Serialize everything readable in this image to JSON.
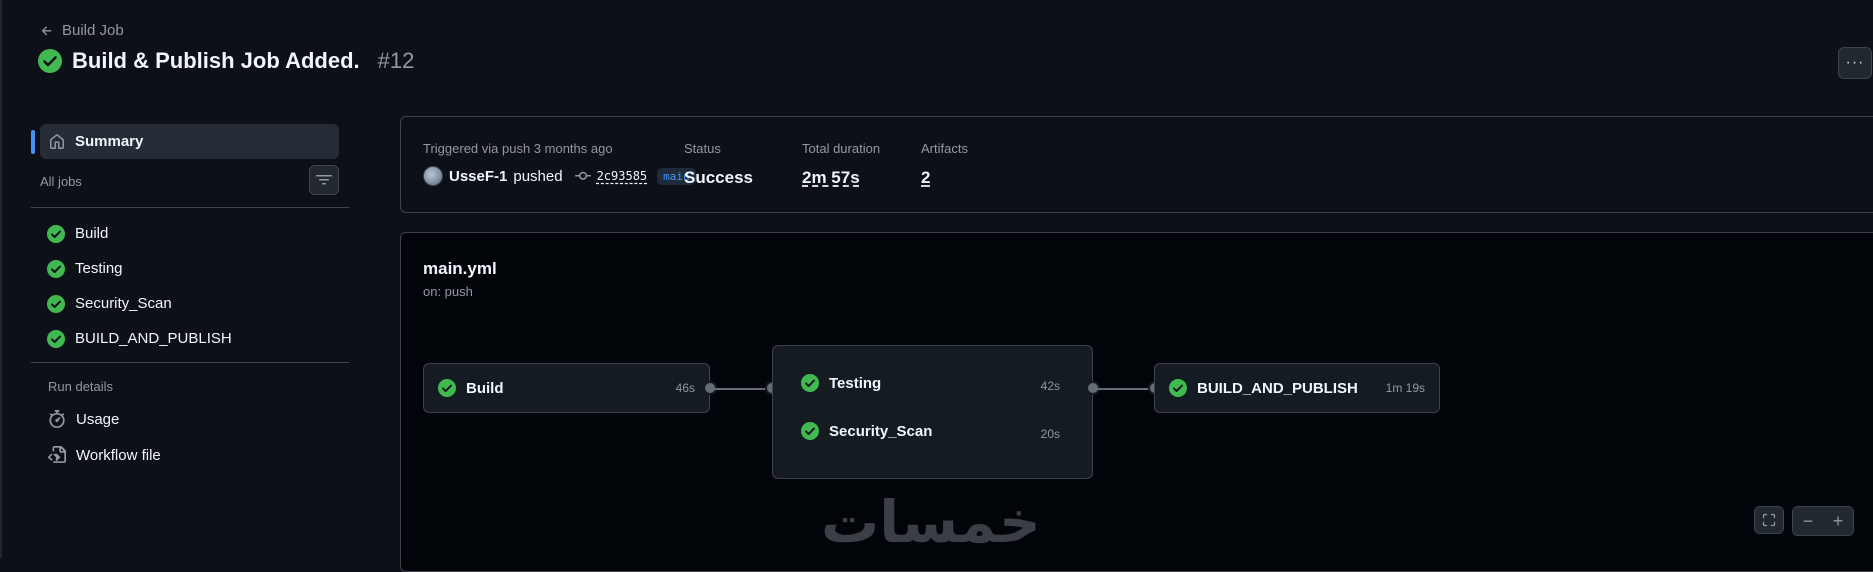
{
  "header": {
    "back_label": "Build Job",
    "run_title": "Build & Publish Job Added.",
    "run_number": "#12",
    "more_label": "···"
  },
  "sidebar": {
    "summary_label": "Summary",
    "all_jobs_label": "All jobs",
    "jobs": [
      {
        "label": "Build",
        "status": "success"
      },
      {
        "label": "Testing",
        "status": "success"
      },
      {
        "label": "Security_Scan",
        "status": "success"
      },
      {
        "label": "BUILD_AND_PUBLISH",
        "status": "success"
      }
    ],
    "run_details_label": "Run details",
    "details": [
      {
        "label": "Usage",
        "icon": "stopwatch-icon"
      },
      {
        "label": "Workflow file",
        "icon": "file-code-icon"
      }
    ]
  },
  "summary": {
    "trigger_label": "Triggered via push 3 months ago",
    "actor": "UsseF-1",
    "action": "pushed",
    "commit_sha": "2c93585",
    "branch": "main",
    "status_label": "Status",
    "status_value": "Success",
    "duration_label": "Total duration",
    "duration_value": "2m 57s",
    "artifacts_label": "Artifacts",
    "artifacts_value": "2"
  },
  "graph": {
    "workflow_file": "main.yml",
    "trigger": "on: push",
    "nodes": {
      "build": {
        "name": "Build",
        "duration": "46s"
      },
      "testing": {
        "name": "Testing",
        "duration": "42s"
      },
      "security": {
        "name": "Security_Scan",
        "duration": "20s"
      },
      "publish": {
        "name": "BUILD_AND_PUBLISH",
        "duration": "1m 19s"
      }
    },
    "watermark": "خمسات",
    "zoom_out": "−",
    "zoom_in": "+"
  },
  "colors": {
    "success": "#3fb950",
    "accent": "#4493f8",
    "background": "#0d1117"
  }
}
